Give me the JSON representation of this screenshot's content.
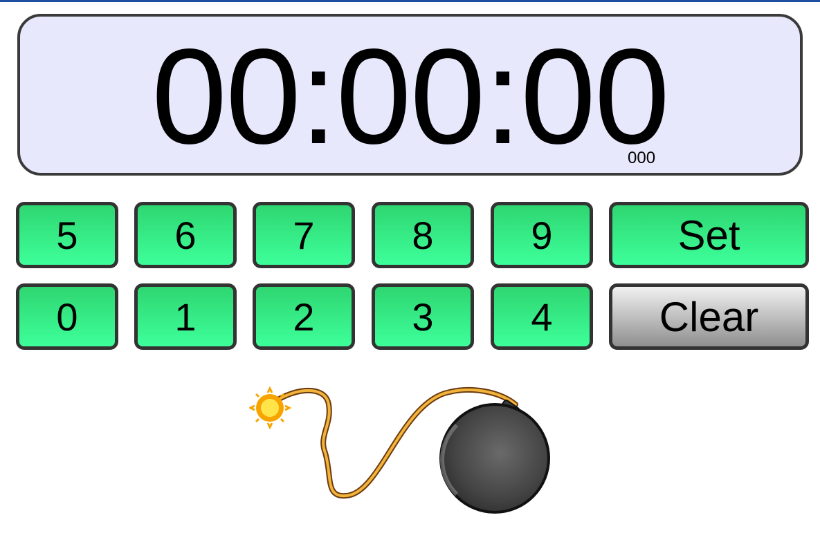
{
  "display": {
    "time": "00:00:00",
    "milliseconds": "000"
  },
  "keypad": {
    "row1": [
      "5",
      "6",
      "7",
      "8",
      "9"
    ],
    "row2": [
      "0",
      "1",
      "2",
      "3",
      "4"
    ],
    "set_label": "Set",
    "clear_label": "Clear"
  },
  "colors": {
    "accent_bar": "#1f4ea0",
    "display_bg": "#e8e8fc",
    "key_green": "#3dff9a",
    "key_gray": "#b0b0b0"
  },
  "icons": {
    "bomb": "bomb-icon"
  }
}
